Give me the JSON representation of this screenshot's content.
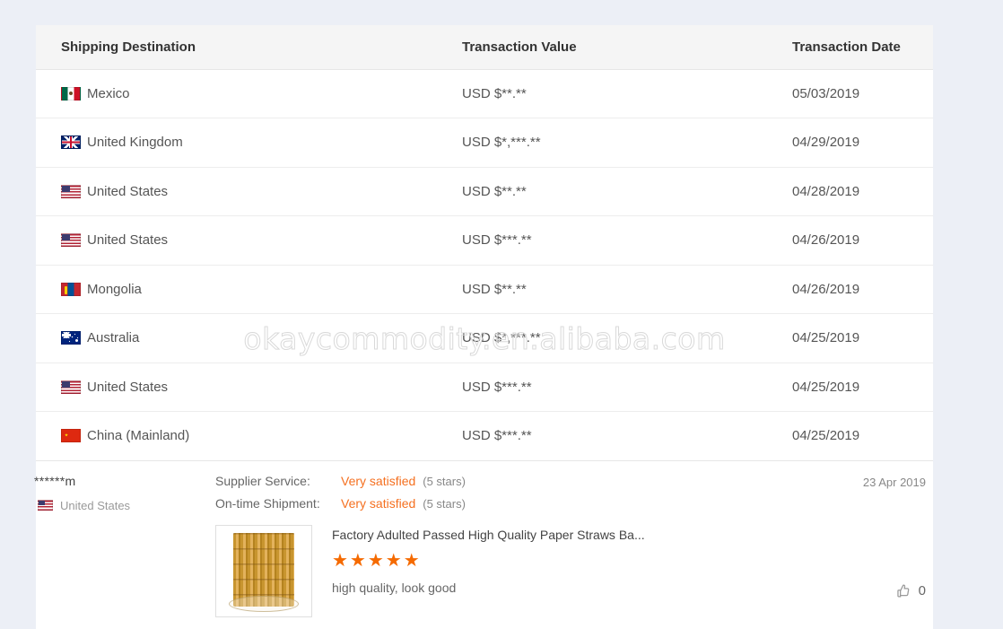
{
  "watermark": "okaycommodity.en.alibaba.com",
  "table": {
    "columns": [
      {
        "key": "destination",
        "label": "Shipping Destination"
      },
      {
        "key": "value",
        "label": "Transaction Value"
      },
      {
        "key": "date",
        "label": "Transaction Date"
      }
    ],
    "rows": [
      {
        "flag": "mx",
        "destination": "Mexico",
        "value": "USD $**.**",
        "date": "05/03/2019"
      },
      {
        "flag": "gb",
        "destination": "United Kingdom",
        "value": "USD $*,***.**",
        "date": "04/29/2019"
      },
      {
        "flag": "us",
        "destination": "United States",
        "value": "USD $**.**",
        "date": "04/28/2019"
      },
      {
        "flag": "us",
        "destination": "United States",
        "value": "USD $***.**",
        "date": "04/26/2019"
      },
      {
        "flag": "mn",
        "destination": "Mongolia",
        "value": "USD $**.**",
        "date": "04/26/2019"
      },
      {
        "flag": "au",
        "destination": "Australia",
        "value": "USD $*,***.**",
        "date": "04/25/2019"
      },
      {
        "flag": "us",
        "destination": "United States",
        "value": "USD $***.**",
        "date": "04/25/2019"
      },
      {
        "flag": "cn",
        "destination": "China (Mainland)",
        "value": "USD $***.**",
        "date": "04/25/2019"
      }
    ]
  },
  "review": {
    "reviewer_name": "******m",
    "reviewer_country": "United States",
    "reviewer_country_flag": "us",
    "date": "23 Apr 2019",
    "ratings": [
      {
        "label": "Supplier Service:",
        "value": "Very satisfied",
        "note": "(5 stars)"
      },
      {
        "label": "On-time Shipment:",
        "value": "Very satisfied",
        "note": "(5 stars)"
      }
    ],
    "product_title": "Factory Adulted Passed High Quality Paper Straws Ba...",
    "product_thumb_alt": "paper-straws-thumbnail",
    "stars": "★★★★★",
    "star_count": 5,
    "comment": "high quality, look good",
    "like_icon": "thumbs-up-icon",
    "like_count": "0"
  },
  "colors": {
    "accent_orange": "#f57020",
    "star_orange": "#f56a00",
    "page_background": "#eceff6",
    "card_background": "#ffffff",
    "header_background": "#f5f5f5"
  }
}
